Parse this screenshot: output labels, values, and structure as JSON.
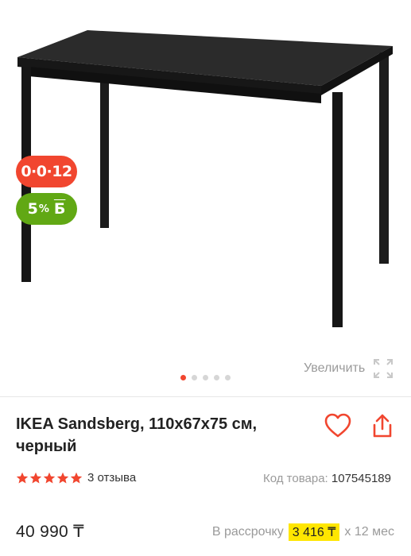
{
  "product": {
    "title": "IKEA Sandsberg, 110x67x75 см, черный",
    "title_line1": "IKEA Sandsberg, 110x67x75 см,",
    "title_line2": "черный",
    "image_icon": "black-table-image",
    "price": "40 990 ₸",
    "rating": 5,
    "reviews": "3 отзыва",
    "sku_label": "Код товара:",
    "sku_value": "107545189"
  },
  "badges": {
    "installment": "0·0·12",
    "cashback_value": "5",
    "cashback_percent": "%",
    "cashback_symbol": "Б"
  },
  "gallery": {
    "zoom_label": "Увеличить",
    "total_slides": 5,
    "active_slide": 1
  },
  "installment": {
    "label": "В рассрочку",
    "amount": "3 416 ₸",
    "term": "х 12 мес"
  },
  "colors": {
    "accent": "#f1462f",
    "cashback": "#61a814",
    "highlight": "#ffe600"
  },
  "icons": [
    "expand-icon",
    "heart-icon",
    "share-icon",
    "star-icon"
  ]
}
